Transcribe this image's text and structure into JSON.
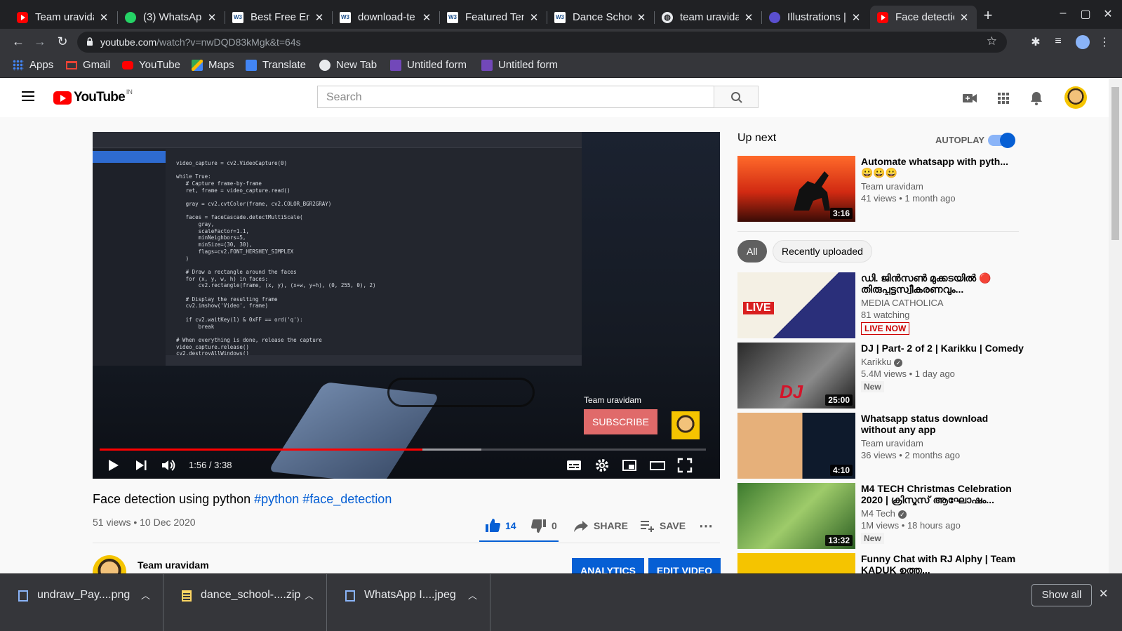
{
  "browser": {
    "tabs": [
      {
        "label": "Team uravida",
        "icon": "youtube-icon"
      },
      {
        "label": "(3) WhatsApp",
        "icon": "whatsapp-icon"
      },
      {
        "label": "Best Free Ent",
        "icon": "w3layouts-icon"
      },
      {
        "label": "download-te",
        "icon": "w3layouts-icon"
      },
      {
        "label": "Featured Ten",
        "icon": "w3layouts-icon"
      },
      {
        "label": "Dance School",
        "icon": "w3layouts-icon"
      },
      {
        "label": "team uravida",
        "icon": "globe-icon"
      },
      {
        "label": "Illustrations |",
        "icon": "illustrations-icon"
      },
      {
        "label": "Face detectio",
        "icon": "youtube-icon",
        "active": true
      }
    ],
    "url_host": "youtube.com",
    "url_path": "/watch?v=nwDQD83kMgk&t=64s",
    "bookmarks": [
      {
        "label": "Apps",
        "icon": "apps-grid-icon"
      },
      {
        "label": "Gmail",
        "icon": "gmail-icon"
      },
      {
        "label": "YouTube",
        "icon": "youtube-icon"
      },
      {
        "label": "Maps",
        "icon": "maps-icon"
      },
      {
        "label": "Translate",
        "icon": "translate-icon"
      },
      {
        "label": "New Tab",
        "icon": "globe-icon"
      },
      {
        "label": "Untitled form",
        "icon": "forms-icon"
      },
      {
        "label": "Untitled form",
        "icon": "forms-icon"
      }
    ]
  },
  "youtube": {
    "logo_text": "YouTube",
    "logo_region": "IN",
    "search_placeholder": "Search",
    "player": {
      "current_time": "1:56",
      "duration": "3:38",
      "time_display": "1:56 / 3:38",
      "played_fraction": 0.532,
      "buffered_fraction": 0.63,
      "card_channel": "Team uravidam",
      "card_subscribe": "SUBSCRIBE"
    },
    "video": {
      "title_plain": "Face detection using python ",
      "hashtag1": "#python",
      "hashtag2": "#face_detection",
      "views": "51 views",
      "date": "10 Dec 2020",
      "meta": "51 views • 10 Dec 2020",
      "likes": "14",
      "dislikes": "0",
      "share": "SHARE",
      "save": "SAVE"
    },
    "channel": {
      "name": "Team uravidam",
      "analytics": "ANALYTICS",
      "edit_video": "EDIT VIDEO"
    },
    "sidebar": {
      "up_next": "Up next",
      "autoplay": "AUTOPLAY",
      "autoplay_on": true,
      "chips": [
        "All",
        "Recently uploaded"
      ],
      "items": [
        {
          "title": "Automate whatsapp with pyth...",
          "title2": "😀😀😀",
          "channel": "Team uravidam",
          "meta": "41 views • 1 month ago",
          "duration": "3:16"
        },
        {
          "title": "ഡി. ജിൻസൺ മുക്കടയിൽ 🔴 തിരുപ്പട്ടസ്വീകരണവും...",
          "channel": "MEDIA CATHOLICA",
          "meta": "81 watching",
          "badge": "LIVE NOW"
        },
        {
          "title": "DJ | Part- 2 of 2 | Karikku | Comedy",
          "channel": "Karikku",
          "meta": "5.4M views • 1 day ago",
          "duration": "25:00",
          "badge": "New"
        },
        {
          "title": "Whatsapp status download without any app",
          "channel": "Team uravidam",
          "meta": "36 views • 2 months ago",
          "duration": "4:10"
        },
        {
          "title": "M4 TECH Christmas Celebration 2020 | ക്രിസ്മസ് ആഘോഷം...",
          "channel": "M4 Tech",
          "meta": "1M views • 18 hours ago",
          "duration": "13:32",
          "badge": "New"
        },
        {
          "title": "Funny Chat with RJ Alphy | Team KADUK ഉത്ത...",
          "channel": "",
          "meta": ""
        }
      ]
    }
  },
  "downloads": {
    "items": [
      {
        "name": "undraw_Pay....png"
      },
      {
        "name": "dance_school-....zip"
      },
      {
        "name": "WhatsApp I....jpeg"
      }
    ],
    "show_all": "Show all"
  },
  "colors": {
    "tab_bg": "#202124",
    "toolbar_bg": "#35363a",
    "yt_red": "#ff0000",
    "yt_blue": "#065fd4"
  }
}
